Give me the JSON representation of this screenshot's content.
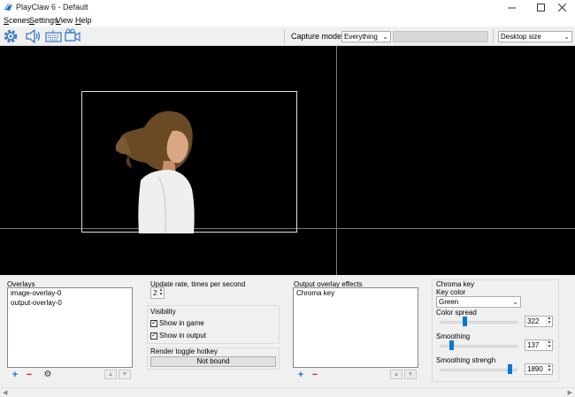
{
  "window": {
    "title": "PlayClaw 6 - Default"
  },
  "menu": {
    "scenes": {
      "first": "S",
      "rest": "cenes"
    },
    "settings": {
      "first": "S",
      "rest": "ettings"
    },
    "view": {
      "first": "V",
      "rest": "iew"
    },
    "help": {
      "first": "H",
      "rest": "elp"
    }
  },
  "toolbar": {
    "capture_mode_label": "Capture mode",
    "capture_mode_value": "Everything",
    "target_value": "",
    "size_value": "Desktop size",
    "icons": [
      "gear-icon",
      "speaker-icon",
      "keyboard-icon",
      "camera-icon"
    ]
  },
  "overlays": {
    "title": "Overlays",
    "items": [
      "image-overlay-0",
      "output-overlay-0"
    ]
  },
  "update_rate": {
    "label": "Update rate, times per second",
    "value": "2"
  },
  "visibility": {
    "title": "Visibility",
    "show_in_game": "Show in game",
    "show_in_output": "Show in output",
    "show_in_game_checked": true,
    "show_in_output_checked": true
  },
  "hotkey": {
    "title": "Render toggle hotkey",
    "value": "Not bound"
  },
  "effects": {
    "title": "Output overlay effects",
    "items": [
      "Chroma key"
    ]
  },
  "chroma": {
    "title": "Chroma key",
    "key_color_label": "Key color",
    "key_color_value": "Green",
    "spread_label": "Color spread",
    "spread_value": "322",
    "smoothing_label": "Smoothing",
    "smoothing_value": "137",
    "strength_label": "Smoothing strengh",
    "strength_value": "1890"
  },
  "colors": {
    "accent": "#0078d7",
    "preview_bg": "#000000"
  }
}
